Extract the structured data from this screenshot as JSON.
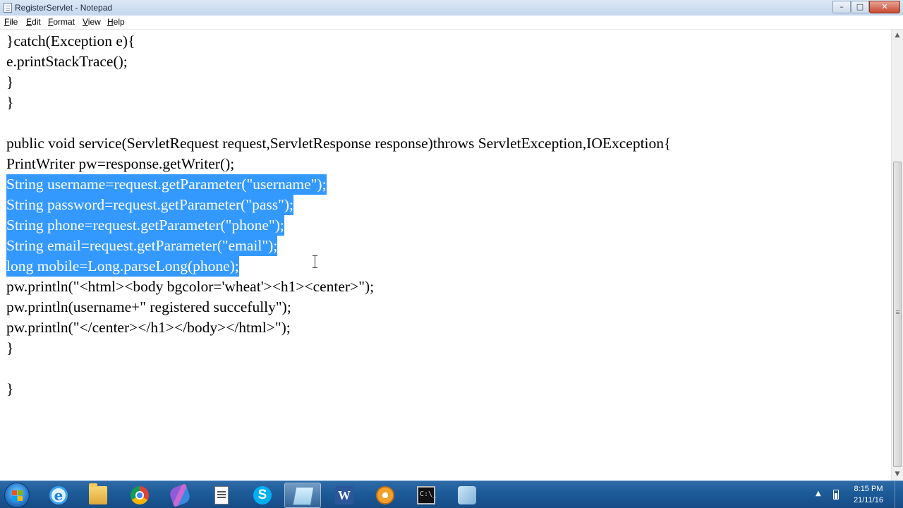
{
  "window": {
    "title": "RegisterServlet - Notepad",
    "min_glyph": "–",
    "max_glyph": "□",
    "close_glyph": "✕"
  },
  "menu": [
    {
      "accel": "F",
      "rest": "ile"
    },
    {
      "accel": "E",
      "rest": "dit"
    },
    {
      "accel": "F",
      "rest": "ormat"
    },
    {
      "accel": "V",
      "rest": "iew"
    },
    {
      "accel": "H",
      "rest": "elp"
    }
  ],
  "editor": {
    "lines": [
      "}catch(Exception e){",
      "e.printStackTrace();",
      "}",
      "}",
      "",
      "public void service(ServletRequest request,ServletResponse response)throws ServletException,IOException{",
      "PrintWriter pw=response.getWriter();",
      "String username=request.getParameter(\"username\");",
      "String password=request.getParameter(\"pass\");",
      "String phone=request.getParameter(\"phone\");",
      "String email=request.getParameter(\"email\");",
      "long mobile=Long.parseLong(phone);",
      "pw.println(\"<html><body bgcolor='wheat'><h1><center>\");",
      "pw.println(username+\" registered succefully\");",
      "pw.println(\"</center></h1></body></html>\");",
      "}",
      "",
      "}"
    ],
    "selected_lines": [
      7,
      8,
      9,
      10,
      11
    ],
    "selection_color": "#3399ff"
  },
  "scrollbar": {
    "up_glyph": "▲",
    "down_glyph": "▼"
  },
  "taskbar": {
    "ie_glyph": "e",
    "skype_glyph": "S",
    "word_glyph": "W",
    "cmd_glyph": "C:\\_",
    "tray_arrow": "▲",
    "time": "8:15 PM",
    "date": "21/11/16"
  }
}
